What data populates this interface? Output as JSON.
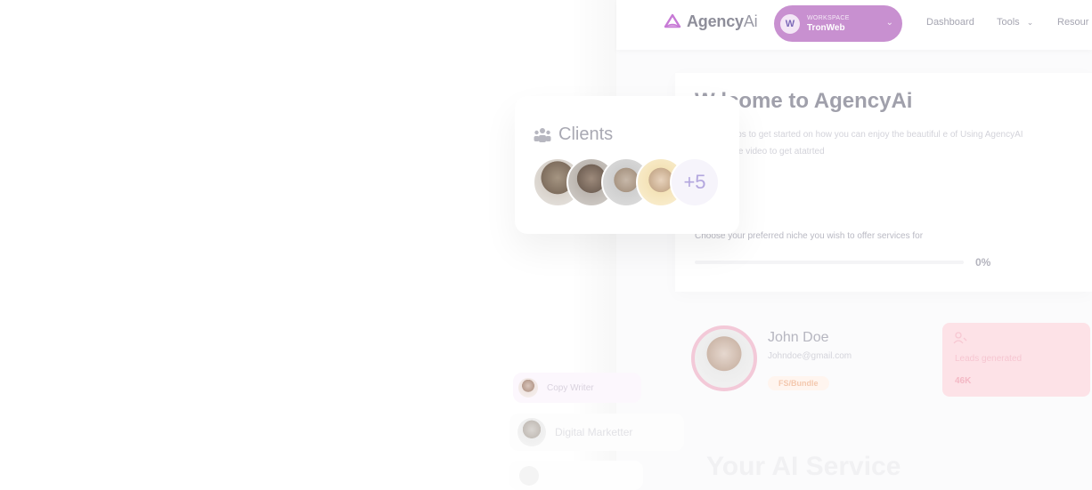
{
  "header": {
    "brand_name": "Agency",
    "brand_suffix": "Ai",
    "workspace_label": "WORKSPACE",
    "workspace_name": "TronWeb",
    "nav": {
      "dashboard": "Dashboard",
      "tools": "Tools",
      "resources": "Resour"
    }
  },
  "welcome": {
    "title": "W  lcome to AgencyAi",
    "description": "display steps to get started on how you can enjoy the beautiful     e of Using AgencyAI or watch the video to get atatrted",
    "niche_prompt": "Choose your preferred niche you wish to offer services for",
    "progress": "0%"
  },
  "clients": {
    "title": "Clients",
    "more_count": "+5"
  },
  "profile": {
    "name": "John Doe",
    "email": "Johndoe@gmail.com",
    "badge": "FS/Bundle"
  },
  "leads": {
    "label": "Leads generated",
    "value": "46K"
  },
  "roles": [
    {
      "label": "Copy Writer"
    },
    {
      "label": "Digital Marketter"
    }
  ],
  "services": {
    "title": "Your AI Service"
  },
  "colors": {
    "workspace_pill": "#c890d0",
    "brand_logo": "#c77ad6",
    "leads_card": "#fde2e7",
    "avatar_more_text": "#b3a6de"
  },
  "icons": [
    "agency-logo-icon",
    "workspace-avatar-icon",
    "chevron-down-icon",
    "clients-group-icon",
    "leads-user-icon"
  ]
}
